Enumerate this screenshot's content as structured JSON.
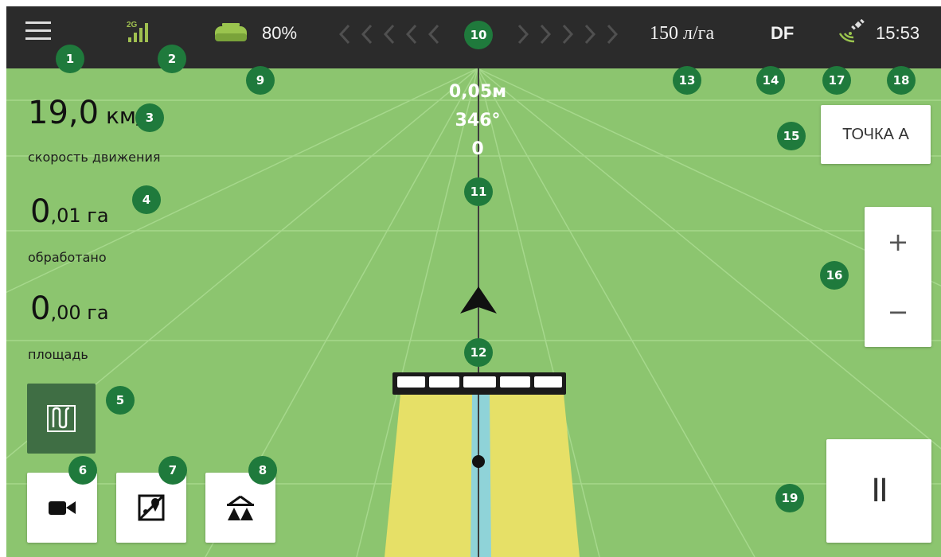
{
  "topbar": {
    "tank_level": "80%",
    "rate": "150 л/га",
    "mode": "DF",
    "time": "15:53"
  },
  "stats": {
    "speed_int": "19,0",
    "speed_unit": "км/ч",
    "speed_label": "скорость движения",
    "processed_int": "0",
    "processed_dec": ",01 га",
    "processed_label": "обработано",
    "area_int": "0",
    "area_dec": ",00 га",
    "area_label": "площадь"
  },
  "navigation": {
    "deviation": "0,05м",
    "heading": "346°",
    "line_number": "0"
  },
  "buttons": {
    "point_a": "ТОЧКА А",
    "zoom_in": "+",
    "zoom_out": "−",
    "pause": "II"
  },
  "callouts": [
    "1",
    "2",
    "3",
    "4",
    "5",
    "6",
    "7",
    "8",
    "9",
    "10",
    "11",
    "12",
    "13",
    "14",
    "15",
    "16",
    "17",
    "18",
    "19"
  ],
  "icons": {
    "menu": "hamburger-menu-icon",
    "signal": "cellular-signal-icon",
    "tank": "tank-icon",
    "gps": "gps-satellite-icon",
    "guidance": "guidance-pattern-icon",
    "camera": "video-camera-icon",
    "map": "map-marker-icon",
    "sprayer": "sprayer-boom-icon",
    "vehicle": "vehicle-arrow-icon"
  },
  "colors": {
    "topbar": "#2b2b2b",
    "field": "#8cc56f",
    "callout": "#1f7a3c",
    "sprayed": "#e6e067",
    "center_stripe": "#8fd3d8",
    "active_button": "#3f6e44"
  }
}
